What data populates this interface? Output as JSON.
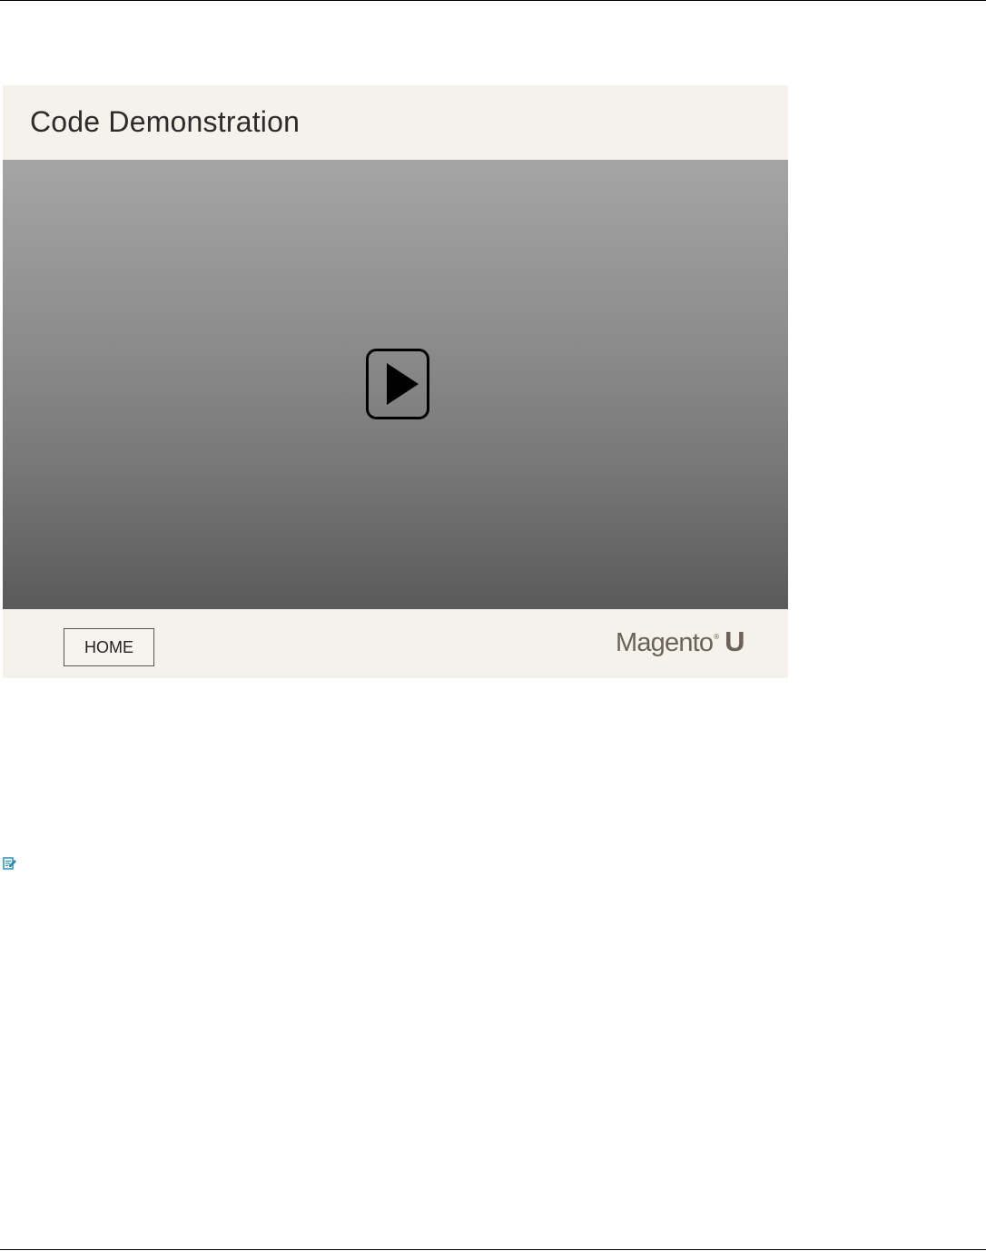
{
  "slide": {
    "title": "Code Demonstration",
    "play_icon": "play-icon",
    "home_label": "HOME",
    "logo": {
      "word": "Magento",
      "reg": "®",
      "letter": "U"
    }
  },
  "note_icon": "note-edit-icon",
  "colors": {
    "slide_bg": "#f5f1eb",
    "video_top": "#a5a5a5",
    "video_bottom": "#5a5a5a",
    "logo": "#6b6259",
    "note_icon": "#2a8fb5"
  }
}
